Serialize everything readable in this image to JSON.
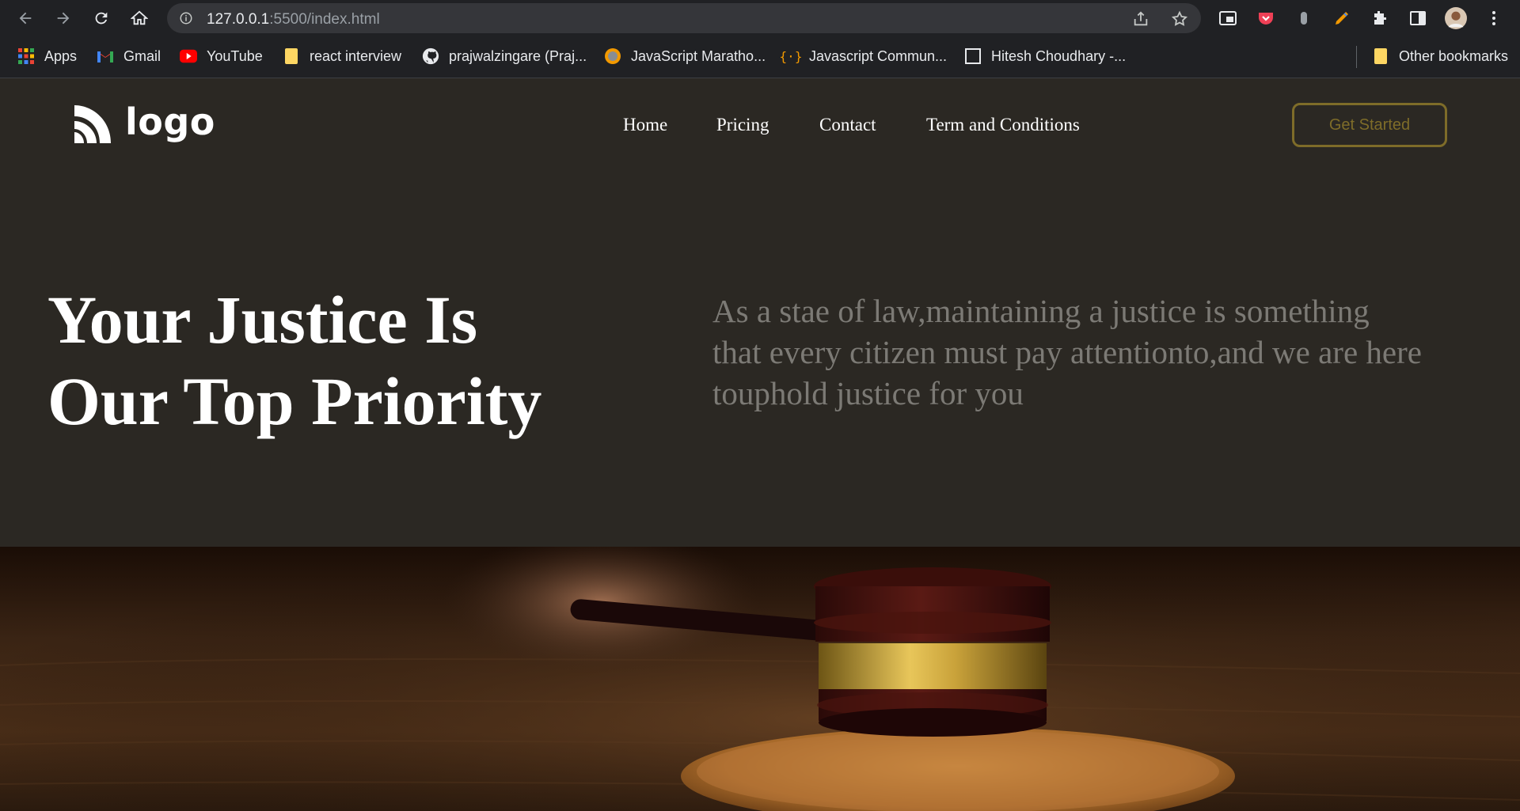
{
  "browser": {
    "url_host": "127.0.0.1",
    "url_path": ":5500/index.html",
    "bookmarks": [
      {
        "label": "Apps",
        "icon": "apps-grid-icon"
      },
      {
        "label": "Gmail",
        "icon": "gmail-icon"
      },
      {
        "label": "YouTube",
        "icon": "youtube-icon"
      },
      {
        "label": "react interview",
        "icon": "folder-icon"
      },
      {
        "label": "prajwalzingare (Praj...",
        "icon": "github-icon"
      },
      {
        "label": "JavaScript Maratho...",
        "icon": "site-icon"
      },
      {
        "label": "Javascript Commun...",
        "icon": "code-braces-icon"
      },
      {
        "label": "Hitesh Choudhary -...",
        "icon": "page-icon"
      }
    ],
    "other_bookmarks": "Other bookmarks"
  },
  "site": {
    "logo_text": "logo",
    "nav": [
      "Home",
      "Pricing",
      "Contact",
      "Term and Conditions"
    ],
    "cta_label": "Get Started",
    "hero_title": "Your Justice Is Our Top Priority",
    "hero_description": "As a stae of law,maintaining a justice is something that every citizen must pay attentionto,and we are here touphold justice for you",
    "accent_color": "#7e6c29",
    "background_color": "#2b2823"
  }
}
